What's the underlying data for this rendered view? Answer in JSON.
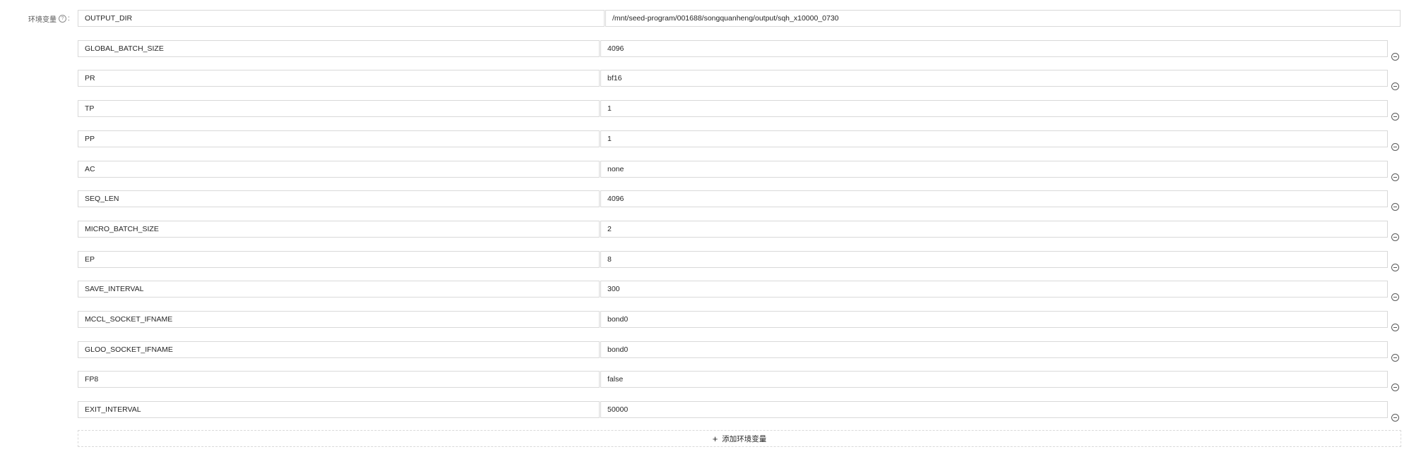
{
  "env_label": "环境变量",
  "help_icon": "question-circle-icon",
  "remove_icon": "minus-circle-icon",
  "plus_icon": "plus-icon",
  "add_button_label": "添加环境变量",
  "rows": [
    {
      "key": "OUTPUT_DIR",
      "value": "/mnt/seed-program/001688/songquanheng/output/sqh_x10000_0730"
    },
    {
      "key": "GLOBAL_BATCH_SIZE",
      "value": "4096"
    },
    {
      "key": "PR",
      "value": "bf16"
    },
    {
      "key": "TP",
      "value": "1"
    },
    {
      "key": "PP",
      "value": "1"
    },
    {
      "key": "AC",
      "value": "none"
    },
    {
      "key": "SEQ_LEN",
      "value": "4096"
    },
    {
      "key": "MICRO_BATCH_SIZE",
      "value": "2"
    },
    {
      "key": "EP",
      "value": "8"
    },
    {
      "key": "SAVE_INTERVAL",
      "value": "300"
    },
    {
      "key": "MCCL_SOCKET_IFNAME",
      "value": "bond0"
    },
    {
      "key": "GLOO_SOCKET_IFNAME",
      "value": "bond0"
    },
    {
      "key": "FP8",
      "value": "false"
    },
    {
      "key": "EXIT_INTERVAL",
      "value": "50000"
    }
  ]
}
